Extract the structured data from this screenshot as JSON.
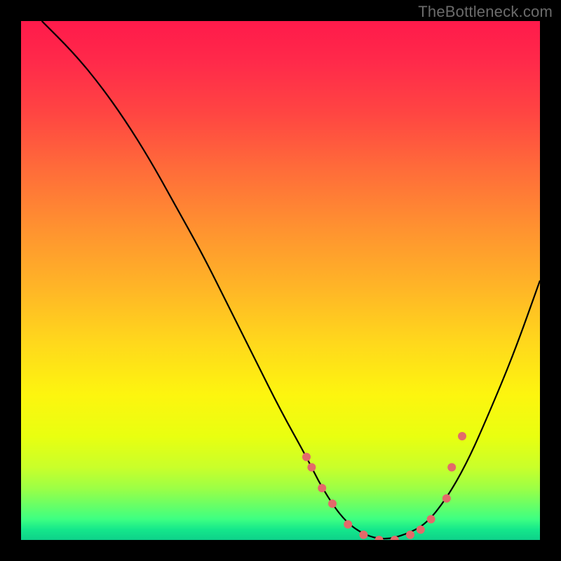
{
  "watermark": "TheBottleneck.com",
  "chart_data": {
    "type": "line",
    "title": "",
    "xlabel": "",
    "ylabel": "",
    "xlim": [
      0,
      100
    ],
    "ylim": [
      0,
      100
    ],
    "annotations": [],
    "background_gradient": {
      "direction": "vertical",
      "stops": [
        {
          "pos": 0,
          "color": "#ff1a4b"
        },
        {
          "pos": 50,
          "color": "#ffc81f"
        },
        {
          "pos": 80,
          "color": "#f5ff10"
        },
        {
          "pos": 100,
          "color": "#0ed18a"
        }
      ]
    },
    "series": [
      {
        "name": "bottleneck-curve",
        "color": "#000000",
        "x": [
          4,
          10,
          15,
          20,
          25,
          30,
          35,
          40,
          45,
          50,
          55,
          58,
          62,
          66,
          70,
          74,
          78,
          82,
          86,
          90,
          95,
          100
        ],
        "values": [
          100,
          94,
          88,
          81,
          73,
          64,
          55,
          45,
          35,
          25,
          16,
          10,
          4,
          1,
          0,
          1,
          3,
          8,
          15,
          24,
          36,
          50
        ]
      }
    ],
    "markers": {
      "name": "highlight-points",
      "color": "#e36a6a",
      "radius_px": 6,
      "x": [
        55,
        56,
        58,
        60,
        63,
        66,
        69,
        72,
        75,
        77,
        79,
        82,
        83,
        85
      ],
      "values": [
        16,
        14,
        10,
        7,
        3,
        1,
        0,
        0,
        1,
        2,
        4,
        8,
        14,
        20
      ]
    }
  }
}
